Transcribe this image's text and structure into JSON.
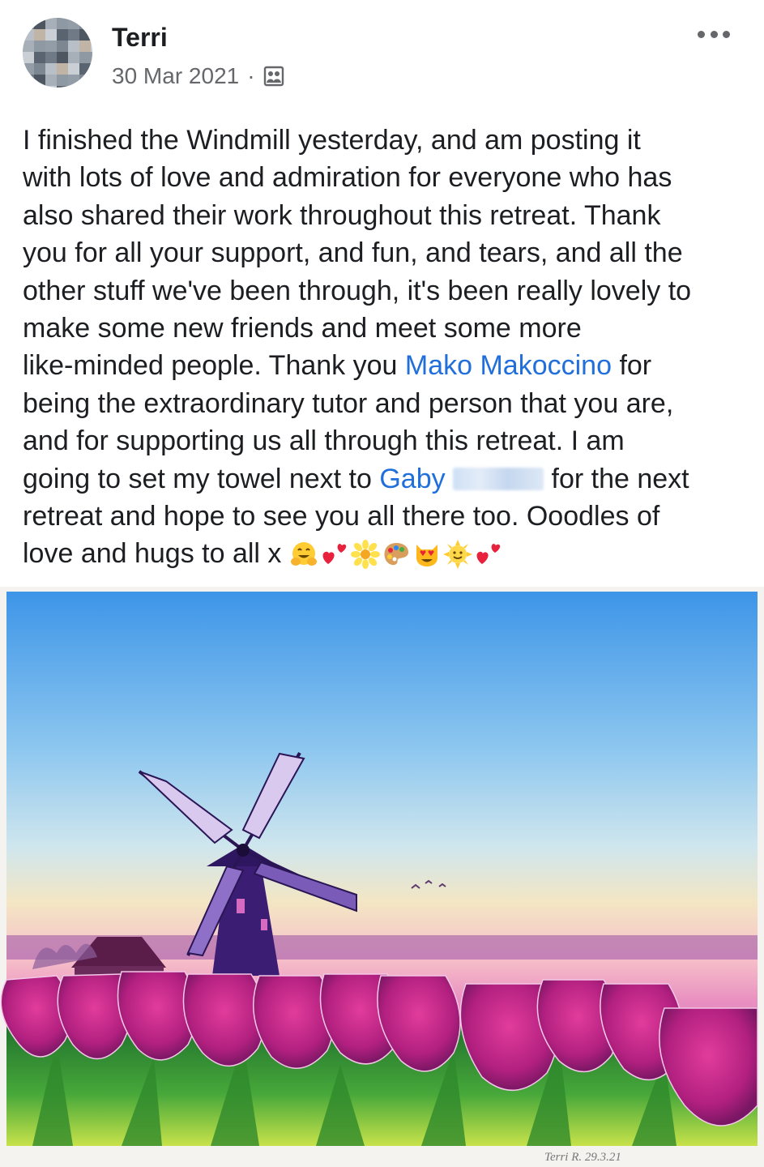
{
  "post": {
    "author": "Terri",
    "date": "30 Mar 2021",
    "separator": "·",
    "audience_icon": "group-audience-icon",
    "more_icon": "more-options-icon",
    "text_lines": [
      [
        "I finished the Windmill yesterday, and am posting it"
      ],
      [
        "with lots of love and admiration for everyone who has"
      ],
      [
        "also shared their work throughout this retreat. Thank"
      ],
      [
        "you for all your support, and fun, and tears, and all the"
      ],
      [
        "other stuff we've been through, it's been really lovely to"
      ],
      [
        "make some new friends and meet some more"
      ],
      [
        "like-minded people. Thank you ",
        "Mako Makoccino",
        " for"
      ],
      [
        "being the extraordinary tutor and person that you are,"
      ],
      [
        "and for supporting us all through this retreat. I am"
      ],
      [
        "going to set my towel next to ",
        "Gaby",
        " for the next"
      ],
      [
        "retreat and hope to see you all there too. Ooodles of"
      ],
      [
        "love and hugs to all x"
      ]
    ],
    "mention_1": "Mako Makoccino",
    "mention_2": "Gaby",
    "emoji": [
      "hugging-face",
      "two-hearts",
      "blossom",
      "artist-palette",
      "smiling-cat-heart-eyes",
      "sun-with-face",
      "two-hearts"
    ],
    "photo": {
      "subject": "windmill-tulip-painting",
      "signature": "Terri R. 29.3.21"
    }
  },
  "colors": {
    "mention": "#216fdb",
    "secondary_text": "#65676b",
    "primary_text": "#1c1e21"
  }
}
